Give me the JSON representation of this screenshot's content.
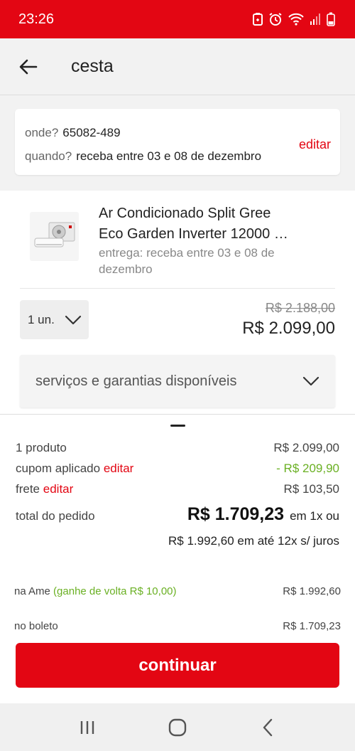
{
  "status_bar": {
    "time": "23:26"
  },
  "header": {
    "title": "cesta",
    "back_icon": "arrow-left-icon"
  },
  "delivery": {
    "where_label": "onde?",
    "where_value": "65082-489",
    "when_label": "quando?",
    "when_value": "receba entre 03 e 08 de dezembro",
    "edit_label": "editar"
  },
  "product": {
    "name_line1": "Ar Condicionado Split Gree",
    "name_line2": "Eco Garden Inverter 12000 …",
    "delivery_text": "entrega: receba entre 03 e 08 de dezembro",
    "quantity": "1 un.",
    "old_price": "R$ 2.188,00",
    "price": "R$ 2.099,00",
    "services_label": "serviços e garantias disponíveis"
  },
  "summary": {
    "products_label": "1 produto",
    "products_value": "R$ 2.099,00",
    "coupon_label": "cupom aplicado",
    "coupon_edit": "editar",
    "coupon_value": "- R$ 209,90",
    "shipping_label": "frete",
    "shipping_edit": "editar",
    "shipping_value": "R$ 103,50",
    "total_label": "total do pedido",
    "total_value": "R$ 1.709,23",
    "total_suffix": "em 1x ou",
    "installments": "R$ 1.992,60 em até 12x s/ juros",
    "ame_label": "na Ame",
    "ame_cashback": "(ganhe de volta R$ 10,00)",
    "ame_value": "R$ 1.992,60",
    "boleto_label": "no boleto",
    "boleto_value": "R$ 1.709,23"
  },
  "cta": {
    "continue_label": "continuar"
  },
  "colors": {
    "brand_red": "#e30613",
    "green": "#6ab023"
  }
}
